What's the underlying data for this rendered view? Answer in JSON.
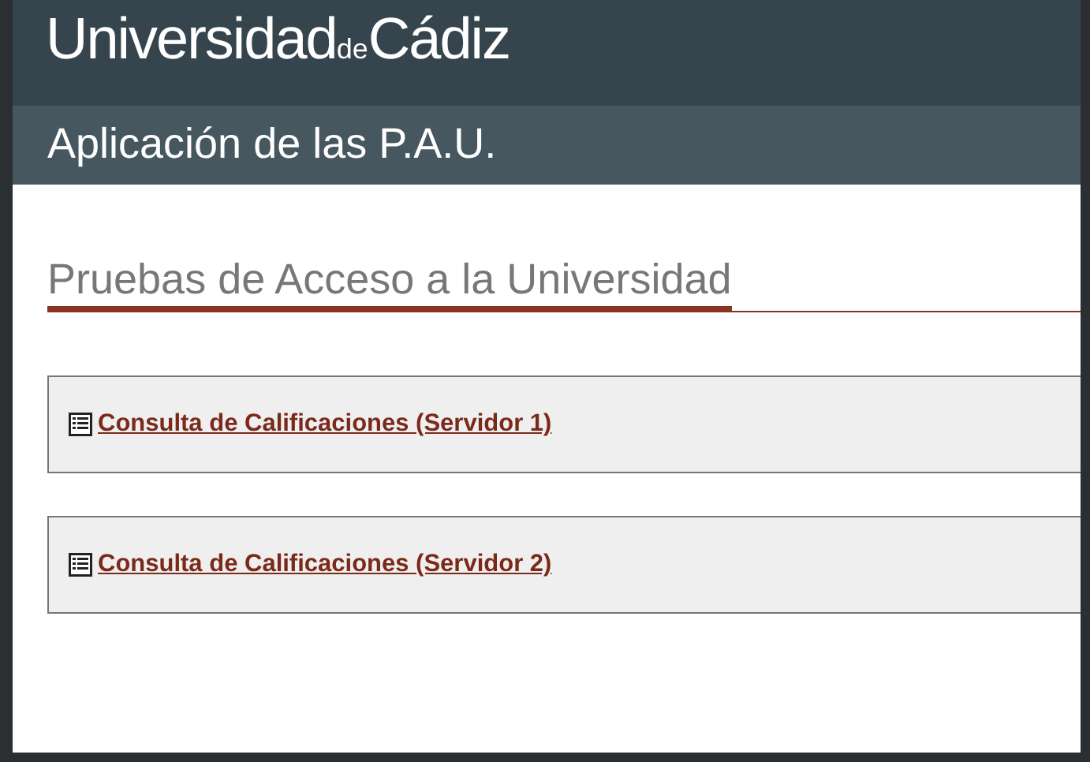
{
  "header": {
    "logo": "Universidad$_{de}$Cádiz"
  },
  "subheader": {
    "title": "Aplicación de las P.A.U."
  },
  "section": {
    "heading": "Pruebas de Acceso a la Universidad"
  },
  "links": [
    {
      "label": "Consulta de Calificaciones (Servidor 1)"
    },
    {
      "label": "Consulta de Calificaciones (Servidor 2)"
    }
  ]
}
